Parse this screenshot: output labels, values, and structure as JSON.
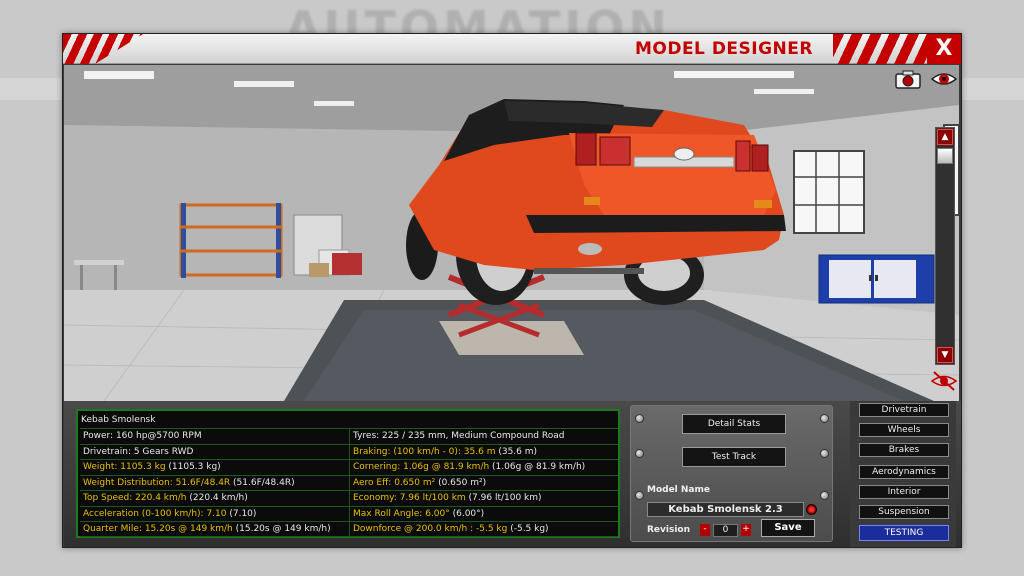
{
  "background": {
    "title": "AUTOMATION"
  },
  "window": {
    "title": "MODEL DESIGNER",
    "close_label": "X",
    "accent_color": "#c40000"
  },
  "viewport": {
    "icons": [
      "camera-icon",
      "eye-icon",
      "hide-eye-icon"
    ],
    "scroll_up": "▲",
    "scroll_down": "▼"
  },
  "stats": {
    "header": "Kebab Smolensk",
    "rows": [
      [
        {
          "label": "Power:",
          "value": " 160 hp@5700 RPM",
          "prev": "",
          "highlight": false
        },
        {
          "label": "Tyres:",
          "value": " 225 / 235 mm, Medium Compound Road",
          "prev": "",
          "highlight": false
        }
      ],
      [
        {
          "label": "Drivetrain:",
          "value": " 5 Gears RWD",
          "prev": "",
          "highlight": false
        },
        {
          "label": "Braking:",
          "value": " (100 km/h - 0): 35.6 m",
          "prev": " (35.6 m)",
          "highlight": true
        }
      ],
      [
        {
          "label": "Weight:",
          "value": " 1105.3 kg",
          "prev": " (1105.3 kg)",
          "highlight": true
        },
        {
          "label": "Cornering:",
          "value": " 1.06g @ 81.9 km/h",
          "prev": " (1.06g @ 81.9 km/h)",
          "highlight": true
        }
      ],
      [
        {
          "label": "Weight Distribution:",
          "value": " 51.6F/48.4R",
          "prev": " (51.6F/48.4R)",
          "highlight": true
        },
        {
          "label": "Aero Eff:",
          "value": " 0.650 m²",
          "prev": " (0.650 m²)",
          "highlight": true
        }
      ],
      [
        {
          "label": "Top Speed:",
          "value": " 220.4 km/h",
          "prev": " (220.4 km/h)",
          "highlight": true
        },
        {
          "label": "Economy:",
          "value": " 7.96 lt/100 km",
          "prev": " (7.96 lt/100 km)",
          "highlight": true
        }
      ],
      [
        {
          "label": "Acceleration (0-100 km/h):",
          "value": " 7.10",
          "prev": " (7.10)",
          "highlight": true
        },
        {
          "label": "Max Roll Angle:",
          "value": " 6.00°",
          "prev": " (6.00°)",
          "highlight": true
        }
      ],
      [
        {
          "label": "Quarter Mile:",
          "value": " 15.20s @ 149 km/h",
          "prev": " (15.20s @ 149 km/h)",
          "highlight": true
        },
        {
          "label": "Downforce @ 200.0 km/h :",
          "value": " -5.5 kg",
          "prev": " (-5.5 kg)",
          "highlight": true
        }
      ]
    ]
  },
  "controls": {
    "detail_stats": "Detail Stats",
    "test_track": "Test Track",
    "model_name_label": "Model Name",
    "model_name_value": "Kebab Smolensk 2.3",
    "revision_label": "Revision",
    "revision_value": "0",
    "minus": "-",
    "plus": "+",
    "save": "Save"
  },
  "tabs": [
    {
      "label": "Drivetrain",
      "active": false
    },
    {
      "label": "Wheels",
      "active": false
    },
    {
      "label": "Brakes",
      "active": false
    },
    {
      "label": "Aerodynamics",
      "active": false
    },
    {
      "label": "Interior",
      "active": false
    },
    {
      "label": "Suspension",
      "active": false
    },
    {
      "label": "TESTING",
      "active": true
    }
  ]
}
